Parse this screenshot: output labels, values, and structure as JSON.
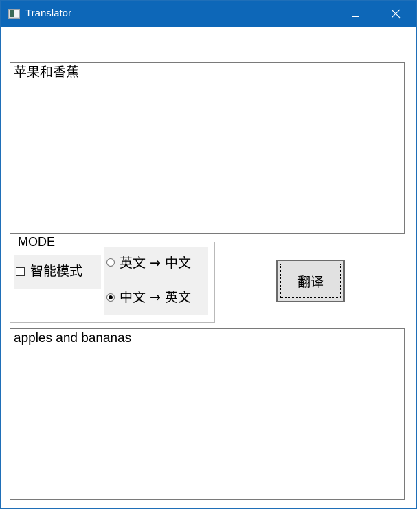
{
  "window": {
    "title": "Translator",
    "controls": {
      "minimize_icon": "minimize-icon",
      "maximize_icon": "maximize-icon",
      "close_icon": "close-icon"
    }
  },
  "input": {
    "text": "苹果和香蕉"
  },
  "mode": {
    "legend": "MODE",
    "smart_mode": {
      "label": "智能模式",
      "checked": false
    },
    "directions": [
      {
        "label": "英文 → 中文",
        "selected": false
      },
      {
        "label": "中文 → 英文",
        "selected": true
      }
    ]
  },
  "translate_button": {
    "label": "翻译"
  },
  "output": {
    "text": "apples and bananas"
  },
  "colors": {
    "titlebar": "#0d67b8",
    "panel": "#f0f0f0",
    "button_face": "#e1e1e1"
  }
}
